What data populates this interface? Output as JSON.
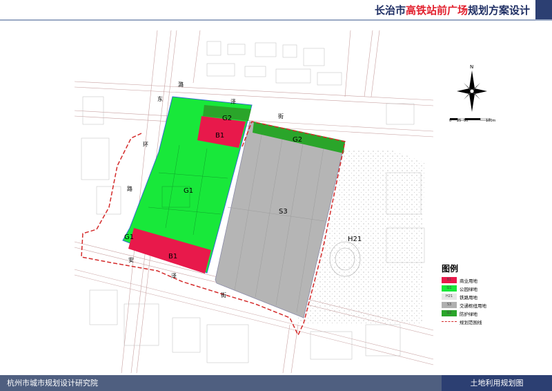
{
  "header": {
    "title_prefix": "长治市",
    "title_highlight": "高铁站前广场",
    "title_suffix": "规划方案设计"
  },
  "footer": {
    "left": "杭州市城市规划设计研究院",
    "right": "土地利用规划图"
  },
  "compass": {
    "north_label": "N"
  },
  "scale_bar": {
    "ticks": [
      "0",
      "25",
      "50",
      "100m"
    ]
  },
  "roads": {
    "north": [
      "东",
      "环",
      "路"
    ],
    "top": [
      "潞",
      "泽",
      "街"
    ],
    "bottom": [
      "安",
      "泽",
      "街"
    ]
  },
  "parcels": {
    "b1_top": "B1",
    "b1_bottom": "B1",
    "g1_main": "G1",
    "g1_small": "G1",
    "g2_left": "G2",
    "g2_right": "G2",
    "s3": "S3",
    "h21": "H21"
  },
  "legend": {
    "title": "图例",
    "items": [
      {
        "code": "B1",
        "label": "商业用地",
        "color": "#e8194b"
      },
      {
        "code": "G1",
        "label": "公园绿地",
        "color": "#18e83a"
      },
      {
        "code": "H21",
        "label": "铁路用地",
        "color": "#e6e6e6"
      },
      {
        "code": "S3",
        "label": "交通枢纽用地",
        "color": "#b0b0b0"
      },
      {
        "code": "G2",
        "label": "防护绿地",
        "color": "#2aa52a"
      }
    ],
    "boundary_label": "规划范围线"
  },
  "colors": {
    "commercial": "#e8194b",
    "park": "#18e83a",
    "protective": "#2aa52a",
    "transport": "#b5b5b5",
    "boundary": "#d42a2a"
  }
}
